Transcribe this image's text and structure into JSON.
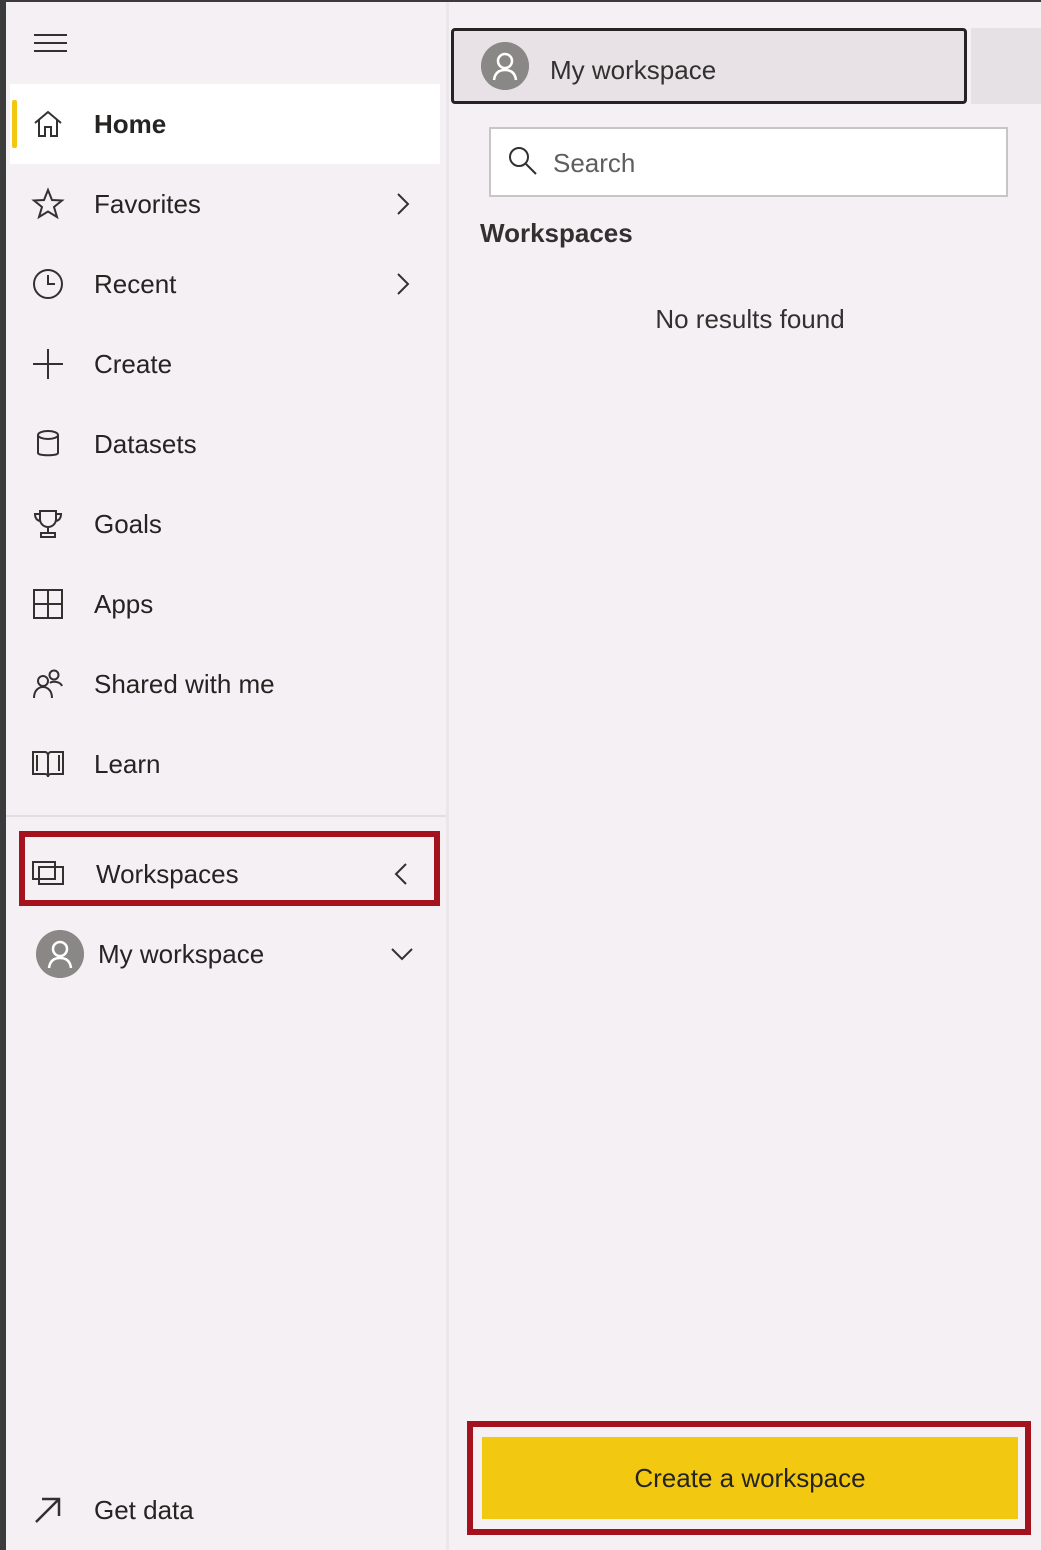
{
  "nav": {
    "items": [
      {
        "label": "Home",
        "icon": "home-icon"
      },
      {
        "label": "Favorites",
        "icon": "star-icon"
      },
      {
        "label": "Recent",
        "icon": "clock-icon"
      },
      {
        "label": "Create",
        "icon": "plus-icon"
      },
      {
        "label": "Datasets",
        "icon": "database-icon"
      },
      {
        "label": "Goals",
        "icon": "trophy-icon"
      },
      {
        "label": "Apps",
        "icon": "apps-icon"
      },
      {
        "label": "Shared with me",
        "icon": "shared-people-icon"
      },
      {
        "label": "Learn",
        "icon": "book-icon"
      }
    ],
    "workspaces": {
      "label": "Workspaces",
      "icon": "workspaces-icon"
    },
    "my_workspace": {
      "label": "My workspace",
      "icon": "avatar"
    },
    "get_data": {
      "label": "Get data",
      "icon": "arrow-up-right-icon"
    }
  },
  "flyout": {
    "tab_label": "My workspace",
    "search": {
      "placeholder": "Search",
      "value": ""
    },
    "section_title": "Workspaces",
    "empty_message": "No results found",
    "create_button": "Create a workspace"
  },
  "colors": {
    "accent": "#f2c811",
    "highlight": "#a4121d",
    "background": "#f5f0f4"
  }
}
